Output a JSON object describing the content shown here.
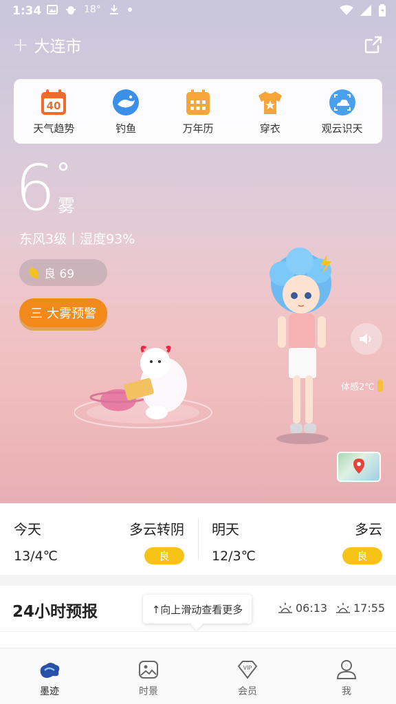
{
  "status_bar": {
    "time": "1:34",
    "temp_indicator": "18°",
    "icons": [
      "image-icon",
      "bug-icon",
      "download-icon",
      "dot-icon",
      "wifi-icon",
      "signal-icon",
      "battery-icon"
    ]
  },
  "header": {
    "add_symbol": "+",
    "city": "大连市"
  },
  "tools": [
    {
      "label": "天气趋势",
      "icon": "calendar-40-icon",
      "badge": "40"
    },
    {
      "label": "钓鱼",
      "icon": "fish-icon"
    },
    {
      "label": "万年历",
      "icon": "calendar-grid-icon"
    },
    {
      "label": "穿衣",
      "icon": "shirt-icon"
    },
    {
      "label": "观云识天",
      "icon": "cloud-scan-icon"
    }
  ],
  "current": {
    "temperature": "6",
    "degree": "°",
    "condition": "雾",
    "wind_humidity": "东风3级丨湿度93%",
    "aqi": "良 69",
    "warning": "大雾预警",
    "warning_icon": "三",
    "feels_like": "体感2℃"
  },
  "days": [
    {
      "name": "今天",
      "condition": "多云转阴",
      "temp": "13/4℃",
      "aqi": "良"
    },
    {
      "name": "明天",
      "condition": "多云",
      "temp": "12/3℃",
      "aqi": "良"
    }
  ],
  "hourly": {
    "title": "24小时预报",
    "hint": "↑向上滑动查看更多",
    "sunrise": "06:13",
    "sunset": "17:55"
  },
  "nav": [
    {
      "label": "墨迹",
      "icon": "moji-logo-icon",
      "active": true
    },
    {
      "label": "时景",
      "icon": "photo-icon",
      "active": false
    },
    {
      "label": "会员",
      "icon": "vip-icon",
      "active": false
    },
    {
      "label": "我",
      "icon": "user-icon",
      "active": false
    }
  ],
  "colors": {
    "accent_orange": "#f28a1b",
    "aqi_yellow": "#f7c316",
    "tool_blue": "#3a8fe8",
    "tool_orange": "#f28a1b"
  }
}
